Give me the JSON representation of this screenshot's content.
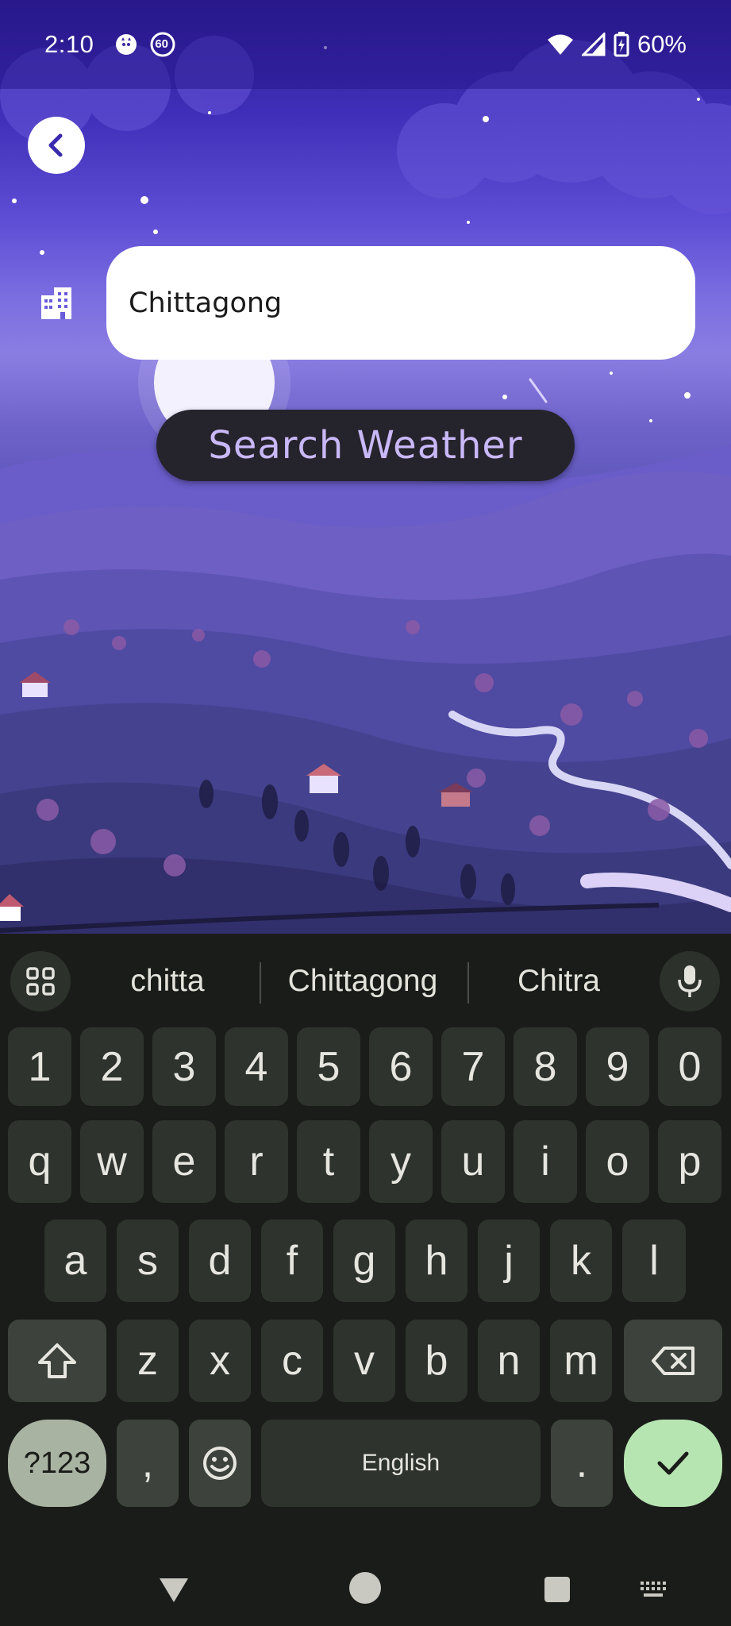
{
  "status_bar": {
    "time": "2:10",
    "notif_badge": "60",
    "battery": "60%"
  },
  "search": {
    "city_value": "Chittagong",
    "button_label": "Search Weather"
  },
  "keyboard": {
    "suggestions": [
      "chitta",
      "Chittagong",
      "Chitra"
    ],
    "row_numbers": [
      "1",
      "2",
      "3",
      "4",
      "5",
      "6",
      "7",
      "8",
      "9",
      "0"
    ],
    "row_top": [
      "q",
      "w",
      "e",
      "r",
      "t",
      "y",
      "u",
      "i",
      "o",
      "p"
    ],
    "row_home": [
      "a",
      "s",
      "d",
      "f",
      "g",
      "h",
      "j",
      "k",
      "l"
    ],
    "row_bottom": [
      "z",
      "x",
      "c",
      "v",
      "b",
      "n",
      "m"
    ],
    "num_mode_label": "?123",
    "comma_label": ",",
    "space_label": "English",
    "period_label": "."
  },
  "colors": {
    "search_text": "#c9b8f7",
    "enter_key": "#b7e5b2",
    "num_mode_key": "#a9b3a2"
  }
}
